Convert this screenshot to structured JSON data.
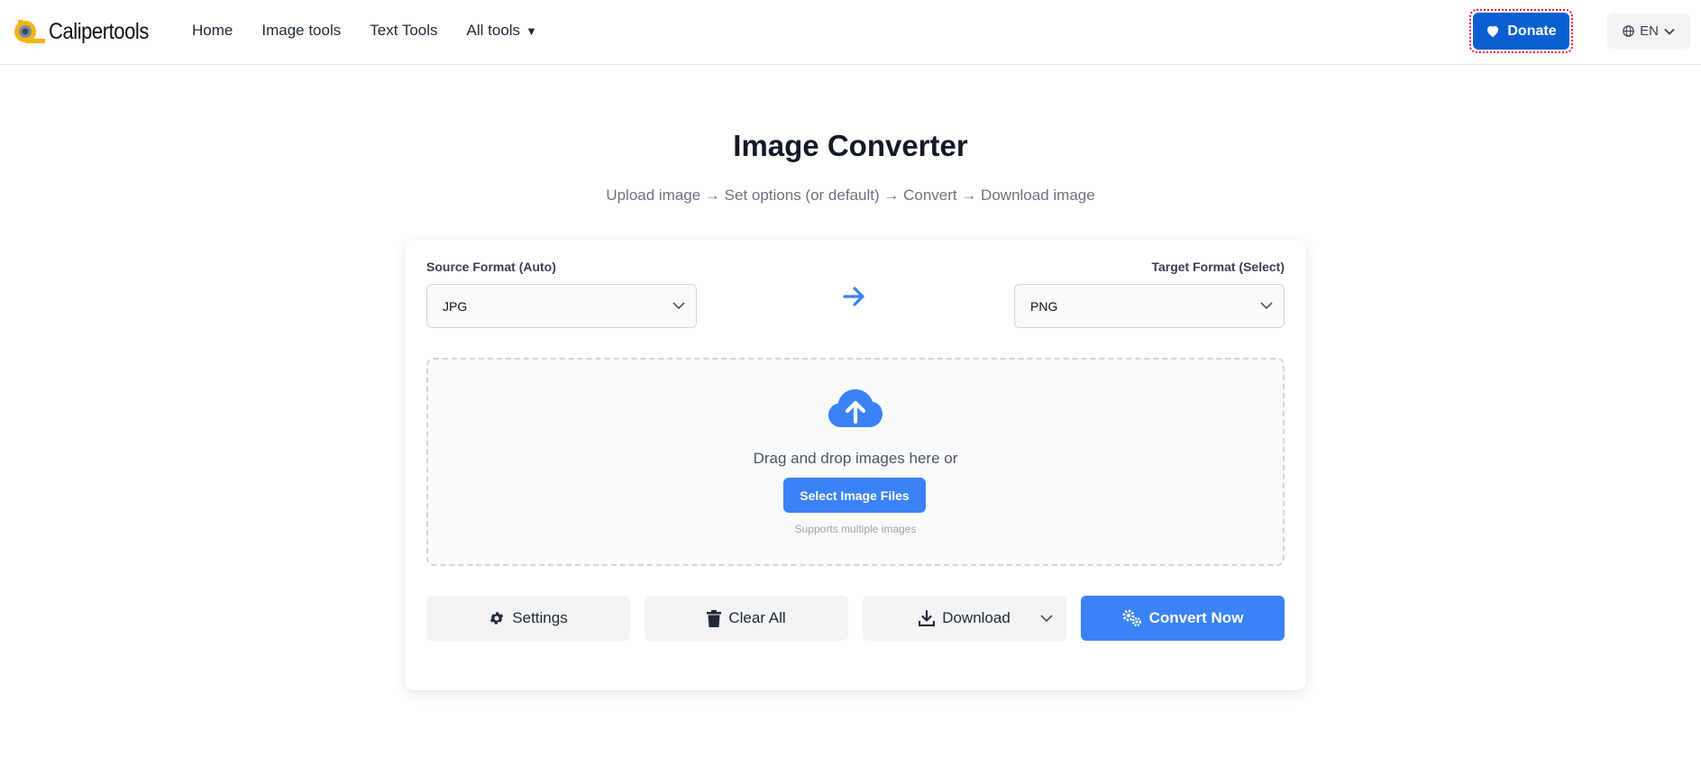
{
  "header": {
    "logo_text": "Calipertools",
    "nav": [
      {
        "label": "Home"
      },
      {
        "label": "Image tools"
      },
      {
        "label": "Text Tools"
      },
      {
        "label": "All tools"
      }
    ],
    "donate_label": "Donate",
    "language_label": "EN"
  },
  "main": {
    "title": "Image Converter",
    "subtitle": "Upload image → Set options (or default) → Convert → Download image"
  },
  "converter": {
    "source_label": "Source Format (Auto)",
    "source_value": "JPG",
    "target_label": "Target Format (Select)",
    "target_value": "PNG",
    "dropzone_text": "Drag and drop images here or",
    "select_files_label": "Select Image Files",
    "dropzone_hint": "Supports multiple images",
    "settings_label": "Settings",
    "clear_label": "Clear All",
    "download_label": "Download",
    "convert_label": "Convert Now"
  },
  "colors": {
    "primary": "#3b82f6",
    "donate": "#0a5fd0",
    "focus_ring": "#e11d48"
  },
  "icons": [
    "logo-icon",
    "caret-down-icon",
    "heart-icon",
    "globe-icon",
    "chevron-down-icon",
    "arrow-right-icon",
    "cloud-upload-icon",
    "gear-icon",
    "trash-icon",
    "download-icon",
    "gears-icon"
  ]
}
